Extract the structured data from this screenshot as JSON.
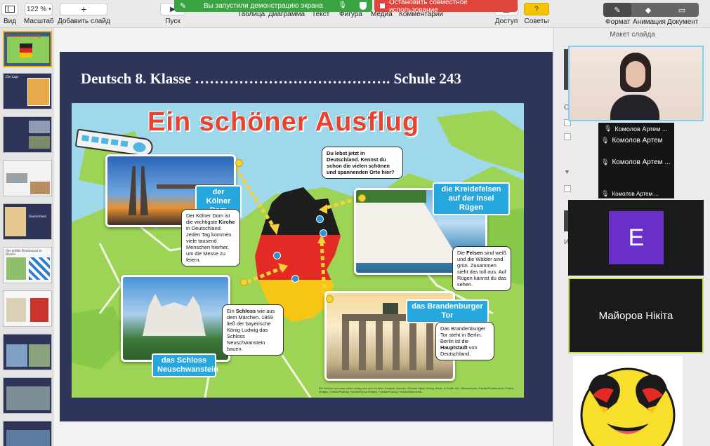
{
  "toolbar": {
    "view_label": "Вид",
    "zoom_value": "122 %",
    "zoom_label": "Масштаб",
    "add_slide_label": "Добавить слайд",
    "play_label": "Пуск",
    "table_label": "Таблица",
    "chart_label": "Диаграмма",
    "text_label": "Текст",
    "shape_label": "Фигура",
    "media_label": "Медиа",
    "comment_label": "Комментарий",
    "access_label": "Доступ",
    "tips_label": "Советы",
    "format_label": "Формат",
    "animation_label": "Анимация",
    "document_label": "Документ"
  },
  "share_banner": {
    "text": "Вы запустили демонстрацию экрана",
    "stop_text": "Остановить совместное использование"
  },
  "colors": {
    "share_green": "#3aa342",
    "stop_red": "#e0443c",
    "slide_bg": "#2f3559",
    "title_red": "#e8432e",
    "label_blue": "#26a7dd",
    "zoom_tile_purple": "#6b2fc9"
  },
  "slide": {
    "header": "Deutsch 8. Klasse …………………………………. Schule 243",
    "poster_title": "Ein schöner Ausflug",
    "intro_bubble": "Du lebst jetzt in Deutschland. Kennst du schon die vielen schönen und spannenden Orte hier?",
    "places": {
      "koeln": {
        "label": "der Kölner Dom",
        "text_pre": "Der Kölner Dom ist die wichtigste ",
        "text_bold": "Kirche",
        "text_post": " in Deutschland. Jeden Tag kommen viele tausend Menschen hierher, um die Messe zu feiern."
      },
      "ruegen": {
        "label": "die Kreidefelsen auf der Insel Rügen",
        "text_pre": "Die ",
        "text_bold": "Felsen",
        "text_post": " sind weiß und die Wälder sind grün. Zusammen sieht das toll aus. Auf Rügen kannst du das sehen."
      },
      "neuschwanstein": {
        "label": "das Schloss Neuschwanstein",
        "text_pre": "Ein ",
        "text_bold": "Schloss",
        "text_post": " wie aus dem Märchen. 1869 ließ der bayerische König Ludwig das Schloss Neuschwanstein bauen."
      },
      "brandenburg": {
        "label": "das Brandenburger Tor",
        "text_pre": "Das Brandenburger Tor steht in Berlin. Berlin ist die ",
        "text_bold": "Hauptstadt",
        "text_post": " von Deutschland."
      }
    },
    "credits": "Ein Service von www.cotler-verlag.com aus ich liebe Deutsch, Autoren: Michael Spike Verlag, Illustr. & Grafik: ML, Bildnachweis: Fotolia/Shutterstock, Fotolia Images, Fotolia/Pixabay, Fotolia/Eyesa Images, Fotolia/Pixabay, Fotolia/Wikimedia..."
  },
  "navigator": {
    "thumbs": [
      {
        "title": "Ein schöner Ausflug"
      },
      {
        "title": "Die Lage"
      },
      {
        "title": ""
      },
      {
        "title": ""
      },
      {
        "title": "Deutschland"
      },
      {
        "title": "Der größte Bundesland in Bayern"
      },
      {
        "title": ""
      },
      {
        "title": ""
      },
      {
        "title": ""
      },
      {
        "title": ""
      }
    ]
  },
  "panel": {
    "title": "Макет слайда",
    "frag_o": "О",
    "frag_i": "И"
  },
  "video": {
    "participant1": "Комолов Артем ...",
    "participant2": "Комолов Артем",
    "participant3": "Комолов Артем ...",
    "participant4": "Комолов Артем ...",
    "e_initial": "E",
    "active_speaker": "Майоров Нікіта"
  }
}
